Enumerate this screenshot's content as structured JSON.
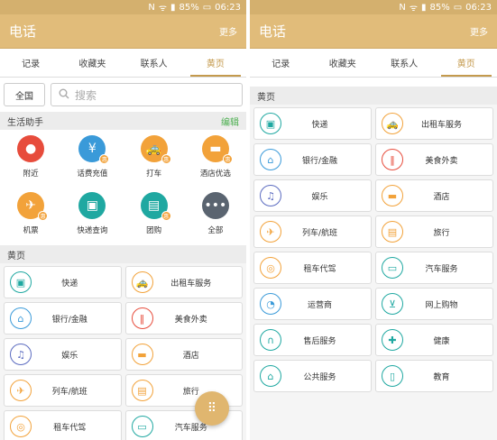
{
  "status": {
    "battery": "85%",
    "time": "06:23"
  },
  "appbar": {
    "title": "电话",
    "more": "更多"
  },
  "tabs": [
    "记录",
    "收藏夹",
    "联系人",
    "黄页"
  ],
  "search": {
    "all_label": "全国",
    "placeholder": "搜索"
  },
  "helpers": {
    "title": "生活助手",
    "edit": "编辑",
    "items": [
      {
        "label": "附近",
        "icon": "location-pin-icon",
        "color": "#e74c3c"
      },
      {
        "label": "话费充值",
        "icon": "phone-topup-icon",
        "color": "#3a9ad9"
      },
      {
        "label": "打车",
        "icon": "taxi-icon",
        "color": "#f2a23a"
      },
      {
        "label": "酒店优选",
        "icon": "hotel-bed-icon",
        "color": "#f2a23a"
      },
      {
        "label": "机票",
        "icon": "airplane-icon",
        "color": "#f2a23a"
      },
      {
        "label": "快递查询",
        "icon": "delivery-truck-icon",
        "color": "#1fa8a1"
      },
      {
        "label": "团购",
        "icon": "shopping-bag-icon",
        "color": "#1fa8a1"
      },
      {
        "label": "全部",
        "icon": "more-dots-icon",
        "color": "#5a6470"
      }
    ]
  },
  "yellowpages": {
    "title": "黄页",
    "items": [
      {
        "label": "快递",
        "icon": "truck-icon",
        "color": "#1fa8a1"
      },
      {
        "label": "出租车服务",
        "icon": "taxi-icon",
        "color": "#f2a23a"
      },
      {
        "label": "银行/金融",
        "icon": "bank-house-icon",
        "color": "#3a9ad9"
      },
      {
        "label": "美食外卖",
        "icon": "fork-knife-icon",
        "color": "#e74c3c"
      },
      {
        "label": "娱乐",
        "icon": "entertainment-icon",
        "color": "#5b6bc0"
      },
      {
        "label": "酒店",
        "icon": "bed-icon",
        "color": "#f2a23a"
      },
      {
        "label": "列车/航班",
        "icon": "train-plane-icon",
        "color": "#f2a23a"
      },
      {
        "label": "旅行",
        "icon": "suitcase-icon",
        "color": "#f2a23a"
      },
      {
        "label": "租车代驾",
        "icon": "steering-wheel-icon",
        "color": "#f2a23a"
      },
      {
        "label": "汽车服务",
        "icon": "car-icon",
        "color": "#1fa8a1"
      },
      {
        "label": "运营商",
        "icon": "satellite-dish-icon",
        "color": "#3a9ad9"
      },
      {
        "label": "网上购物",
        "icon": "shopping-cart-icon",
        "color": "#1fa8a1"
      },
      {
        "label": "售后服务",
        "icon": "headset-icon",
        "color": "#1fa8a1"
      },
      {
        "label": "健康",
        "icon": "medical-kit-icon",
        "color": "#1fa8a1"
      },
      {
        "label": "公共服务",
        "icon": "public-building-icon",
        "color": "#1fa8a1"
      },
      {
        "label": "教育",
        "icon": "book-icon",
        "color": "#1fa8a1"
      }
    ]
  }
}
